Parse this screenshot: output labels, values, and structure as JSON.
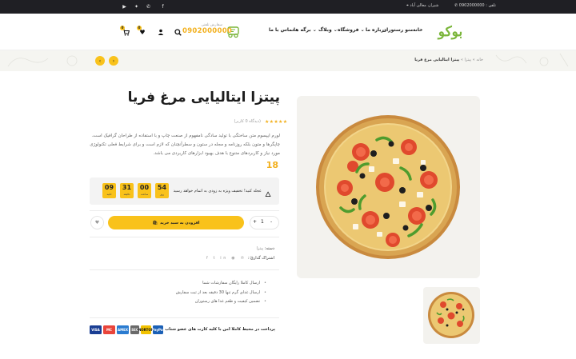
{
  "topbar": {
    "phone": "تلفن : 0902000000",
    "address": "شیراز، معالی آباد",
    "social": [
      "facebook-icon",
      "whatsapp-icon",
      "twitter-icon",
      "youtube-icon"
    ]
  },
  "header": {
    "logo": "بوکو",
    "nav": [
      "خانه",
      "منو رستوران",
      "درباره ما",
      "فروشگاه",
      "وبلاگ",
      "برگه ها",
      "تماس با ما"
    ],
    "phone_label": "سفارش تلفنی",
    "phone_number": "0902000000",
    "cart_count": "0",
    "wishlist_count": "0"
  },
  "breadcrumb": {
    "home": "خانه",
    "sep": "»",
    "category": "پیتزا",
    "current": "پیتزا ایتالیایی مرغ فریا"
  },
  "product": {
    "title": "پیتزا ایتالیایی مرغ فریا",
    "stars": "★★★★★",
    "rating_text": "(دیدگاه 0 کاربر)",
    "description": "لورم ایپسوم متن ساختگی با تولید سادگی نامفهوم از صنعت چاپ و با استفاده از طراحان گرافیک است. چاپگرها و متون بلکه روزنامه و مجله در ستون و سطرآنچنان که لازم است و برای شرایط فعلی تکنولوژی مورد نیاز و کاربردهای متنوع با هدف بهبود ابزارهای کاربردی می باشد.",
    "price": "18",
    "deal_text": "عجله کنید! تخفیف ویژه به زودی به اتمام خواهد رسید",
    "countdown": [
      {
        "value": "54",
        "unit": "روز"
      },
      {
        "value": "00",
        "unit": "ساعت"
      },
      {
        "value": "31",
        "unit": "دقیقه"
      },
      {
        "value": "09",
        "unit": "ثانیه"
      }
    ],
    "qty": "1",
    "qty_minus": "-",
    "qty_plus": "+",
    "add_to_cart": "افزودن به سبد خرید",
    "category_label": "دسته:",
    "category_value": "پیتزا",
    "share_label": "اشتراک گذاری :",
    "share_icons": "f t in ◉ ℗ ✉",
    "features": [
      "ارسال کاملا رایگان سفارشات شما",
      "ارسال غذای گرم تنها 30 دقیقه بعد از ثبت سفارش",
      "تضمین کیفیت و طعم غذا های رستوران"
    ],
    "payment_text": "پرداخت در محیط کاملا امن با کلیه کارت های عضو شتاب",
    "payment_cards": [
      "VISA",
      "MC",
      "AMEX",
      "SEC",
      "NORTON",
      "PayPal"
    ]
  },
  "colors": {
    "accent": "#f9c21b",
    "brand_green": "#7ab53a",
    "topbar": "#1f1f24"
  }
}
